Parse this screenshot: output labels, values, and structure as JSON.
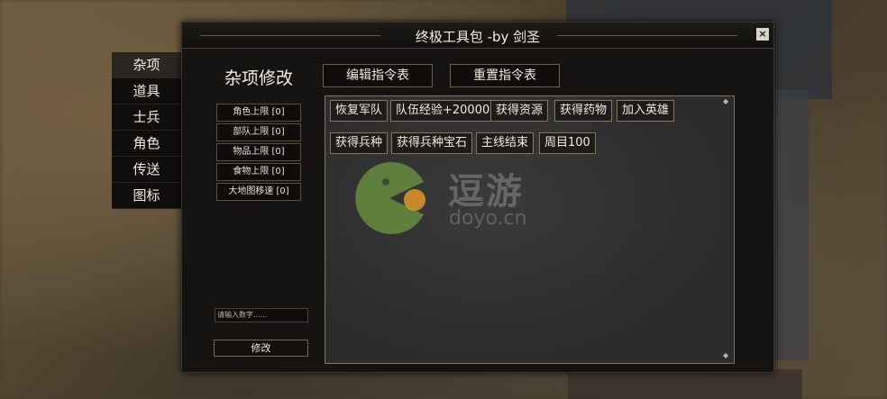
{
  "dialog": {
    "title": "终极工具包 -by 剑圣",
    "close_label": "×"
  },
  "sidebar": {
    "items": [
      {
        "label": "杂项",
        "active": true
      },
      {
        "label": "道具",
        "active": false
      },
      {
        "label": "士兵",
        "active": false
      },
      {
        "label": "角色",
        "active": false
      },
      {
        "label": "传送",
        "active": false
      },
      {
        "label": "图标",
        "active": false
      }
    ]
  },
  "main": {
    "section_title": "杂项修改",
    "edit_table_label": "编辑指令表",
    "reset_table_label": "重置指令表",
    "limits": [
      "角色上限 [0]",
      "部队上限 [0]",
      "物品上限 [0]",
      "食物上限 [0]",
      "大地图移速 [0]"
    ],
    "number_input_placeholder": "请输入数字......",
    "modify_label": "修改"
  },
  "commands": {
    "row1": [
      "恢复军队",
      "队伍经验+20000",
      "获得资源",
      "获得药物",
      "加入英雄"
    ],
    "row2": [
      "获得兵种",
      "获得兵种宝石",
      "主线结束",
      "周目100"
    ]
  },
  "watermark": {
    "text": "逗游",
    "sub": "doyo.cn",
    "logo_colors": [
      "#7cb342",
      "#f5a623"
    ]
  }
}
